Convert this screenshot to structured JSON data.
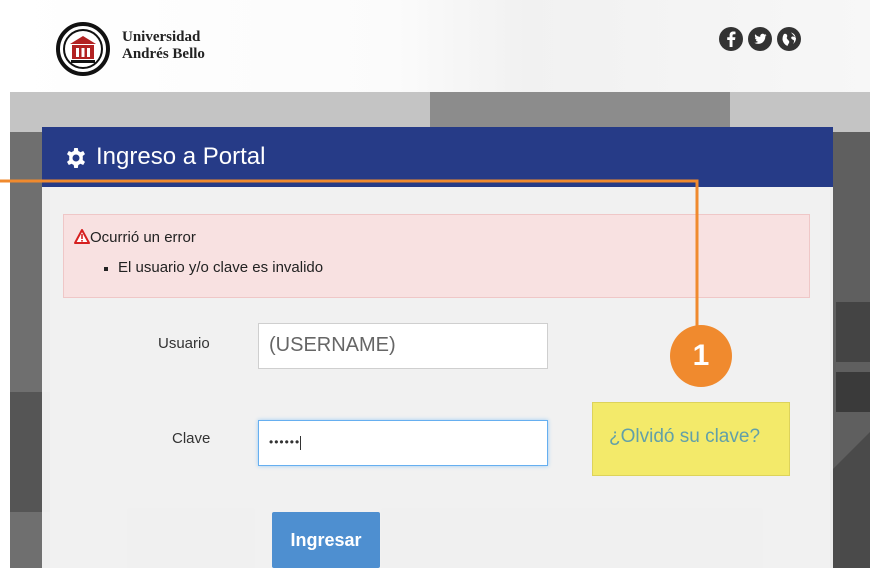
{
  "header": {
    "university_line1": "Universidad",
    "university_line2": "Andrés Bello",
    "social_icons": [
      "facebook-icon",
      "twitter-icon",
      "globe-icon"
    ]
  },
  "panel": {
    "title": "Ingreso a Portal",
    "header_color": "#263b87"
  },
  "alert": {
    "title": "Ocurrió un error",
    "items": [
      "El usuario y/o clave es invalido"
    ]
  },
  "form": {
    "user_label": "Usuario",
    "user_value": "(USERNAME)",
    "pass_label": "Clave",
    "pass_value": "••••••",
    "forgot_link": "¿Olvidó su clave?",
    "submit_label": "Ingresar"
  },
  "callout": {
    "number": "1",
    "color": "#f08a2e",
    "highlight_color": "#f3ea6a"
  }
}
